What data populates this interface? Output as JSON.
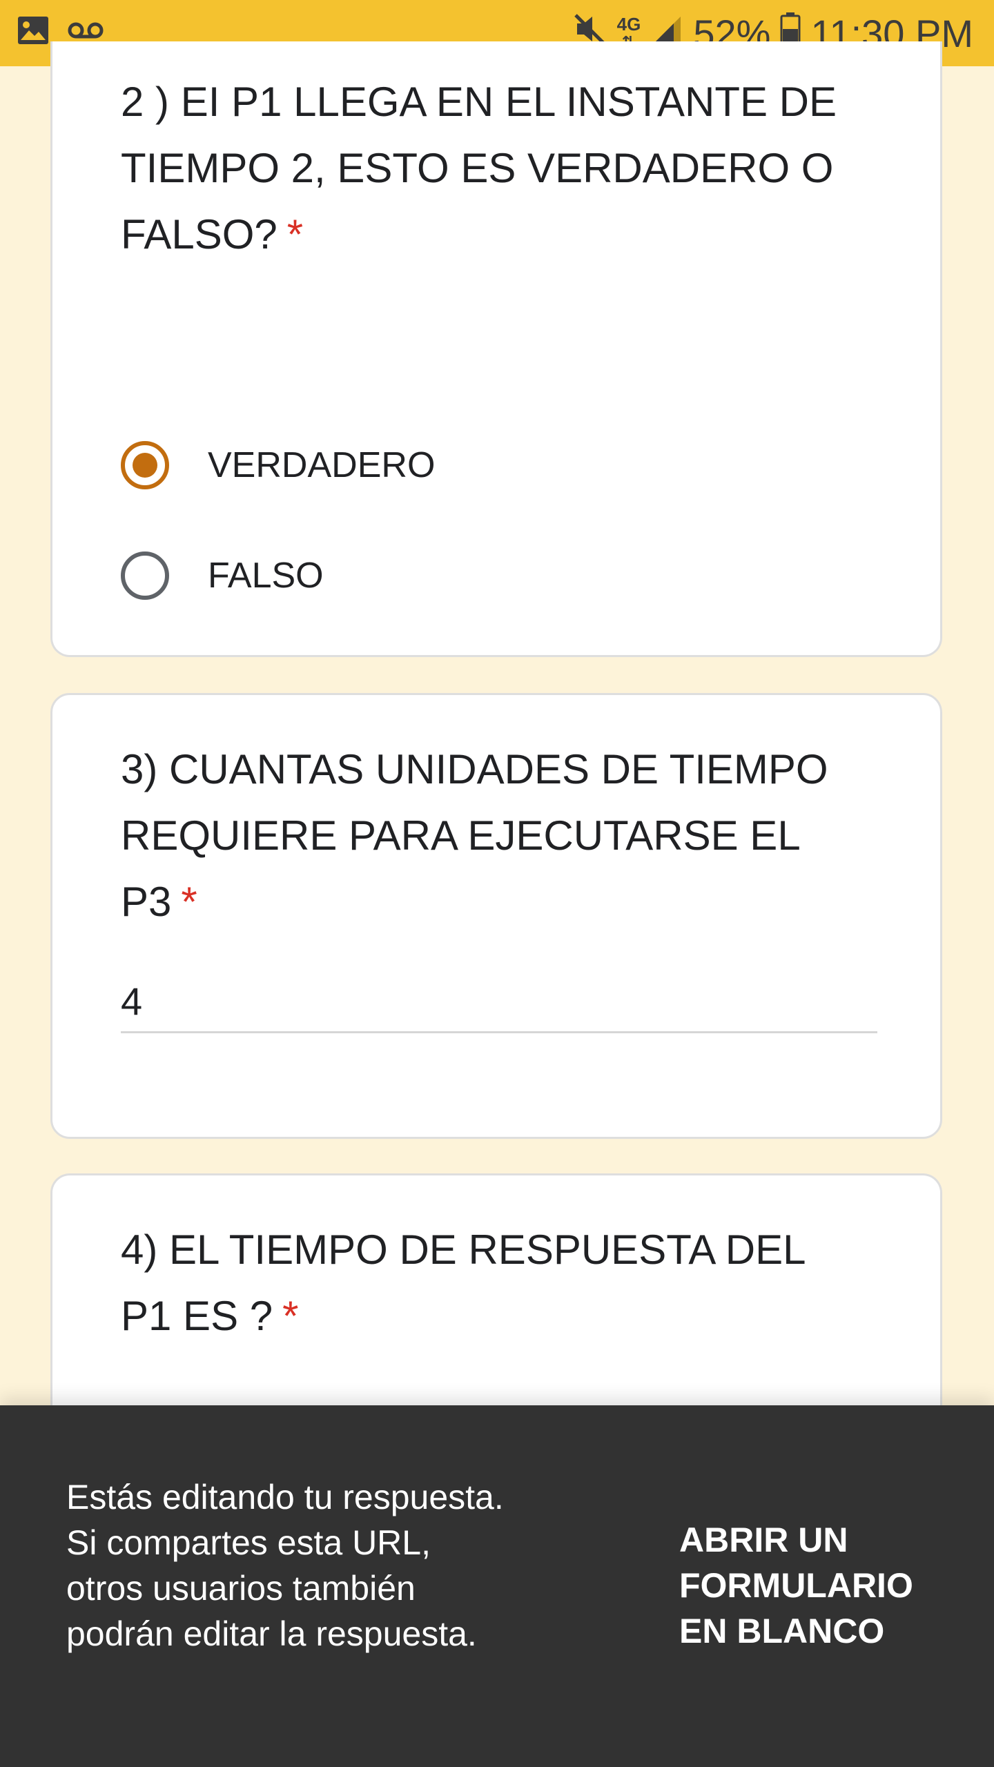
{
  "status_bar": {
    "network": "4G",
    "battery": "52%",
    "time": "11:30 PM",
    "icons": [
      "image-icon",
      "voicemail-icon",
      "mute-icon",
      "network-4g-icon",
      "signal-icon",
      "battery-icon"
    ]
  },
  "questions": [
    {
      "text": "2 ) EI P1 LLEGA EN EL INSTANTE DE TIEMPO 2, ESTO ES VERDADERO O FALSO?",
      "required_mark": "*",
      "type": "radio",
      "options": [
        {
          "label": "VERDADERO",
          "selected": true
        },
        {
          "label": "FALSO",
          "selected": false
        }
      ]
    },
    {
      "text": "3) CUANTAS UNIDADES DE TIEMPO REQUIERE PARA EJECUTARSE EL P3",
      "required_mark": "*",
      "type": "text",
      "answer": "4"
    },
    {
      "text": "4) EL TIEMPO DE RESPUESTA DEL P1 ES ?",
      "required_mark": "*"
    }
  ],
  "banner": {
    "message": "Estás editando tu respuesta. Si compartes esta URL, otros usuarios también podrán editar la respuesta.",
    "action_label": "ABRIR UN FORMULARIO EN BLANCO"
  },
  "colors": {
    "status_bar": "#F4C22F",
    "page_background": "#FDF3D9",
    "accent": "#C26D0F",
    "required": "#D93025",
    "banner_background": "#323232"
  }
}
